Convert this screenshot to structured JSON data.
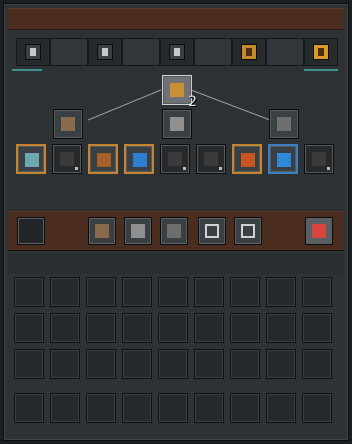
{
  "window": {
    "title": ""
  },
  "tabs": [
    {
      "name": "sword-tab",
      "icon": "sword-icon",
      "active": true
    },
    {
      "name": "scroll-tab",
      "icon": "star-scroll-icon",
      "active": true
    },
    {
      "name": "wand-tab",
      "icon": "sparkle-wand-icon",
      "active": true
    },
    {
      "name": "pillar-tab",
      "icon": "gold-pillar-icon",
      "active": false
    },
    {
      "name": "crown-tab",
      "icon": "crown-icon",
      "active": false
    }
  ],
  "tree": {
    "root": {
      "icon": "treasure-chest-icon",
      "count": "2"
    },
    "level1": [
      {
        "name": "hammer-node",
        "icon": "hammer-icon"
      },
      {
        "name": "skull-blade-node",
        "icon": "skull-blade-icon"
      },
      {
        "name": "rifle-node",
        "icon": "rifle-icon"
      }
    ],
    "level2": [
      {
        "name": "rune-node",
        "icon": "rune-icon",
        "style": "orange"
      },
      {
        "name": "shadow-node-1",
        "icon": "shadow-creature-icon",
        "style": "locked"
      },
      {
        "name": "flame-beast-node",
        "icon": "flame-beast-icon",
        "style": "orange"
      },
      {
        "name": "moon-orb-node",
        "icon": "blue-moon-icon",
        "style": "orange"
      },
      {
        "name": "shadow-node-2",
        "icon": "shadow-creature-icon",
        "style": "locked"
      },
      {
        "name": "shadow-node-3",
        "icon": "shadow-creature-icon",
        "style": "locked"
      },
      {
        "name": "lava-node",
        "icon": "lava-creature-icon",
        "style": "orange"
      },
      {
        "name": "crescent-node",
        "icon": "blue-crescent-icon",
        "style": "blue"
      },
      {
        "name": "shadow-node-4",
        "icon": "shadow-creature-icon",
        "style": "locked"
      }
    ]
  },
  "action_bar": [
    {
      "name": "empty-slot",
      "icon": ""
    },
    {
      "name": "hammer-button",
      "icon": "hammer-icon"
    },
    {
      "name": "skull-blade-button",
      "icon": "skull-blade-icon"
    },
    {
      "name": "rifle-button",
      "icon": "rifle-icon"
    },
    {
      "name": "ring-button-1",
      "icon": "ring-icon"
    },
    {
      "name": "ring-button-2",
      "icon": "ring-icon"
    },
    {
      "name": "undo-button",
      "icon": "red-return-icon"
    }
  ],
  "inventory": {
    "rows": 4,
    "cols": 9
  },
  "colors": {
    "brown_bar": "#4b2d1f",
    "gold": "#c58a2c",
    "teal": "#3f8f8f",
    "orange_border": "#c78430",
    "blue_border": "#3c7fbf"
  }
}
